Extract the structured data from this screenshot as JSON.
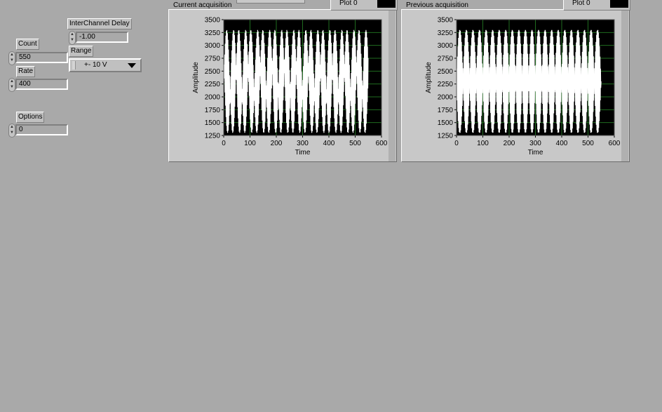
{
  "controls": {
    "count": {
      "label": "Count",
      "value": "550"
    },
    "rate": {
      "label": "Rate",
      "value": "400"
    },
    "options": {
      "label": "Options",
      "value": "0"
    },
    "interchannel_delay": {
      "label": "InterChannel Delay",
      "value": "-1.00"
    },
    "range": {
      "label": "Range",
      "value": "+- 10 V"
    }
  },
  "graphs": [
    {
      "title": "Current acquisition",
      "legend": "Plot 0"
    },
    {
      "title": "Previous acquisition",
      "legend": "Plot 0"
    }
  ],
  "colors": {
    "background": "#a9a9a9",
    "plot_bg": "#000000",
    "grid": "#1f6b1f",
    "trace": "#ffffff"
  },
  "chart_data": [
    {
      "type": "line",
      "title": "Current acquisition",
      "xlabel": "Time",
      "ylabel": "Amplitude",
      "xlim": [
        0,
        600
      ],
      "ylim": [
        1250,
        3500
      ],
      "x_ticks": [
        0,
        100,
        200,
        300,
        400,
        500,
        600
      ],
      "y_ticks": [
        1250,
        1500,
        1750,
        2000,
        2250,
        2500,
        2750,
        3000,
        3250,
        3500
      ],
      "grid": true,
      "series": [
        {
          "points": 550,
          "x_range": [
            0,
            549
          ],
          "y_range": [
            1300,
            3300
          ],
          "waveform": "dense oscillation, many interleaved cycles",
          "cycles": 12
        }
      ]
    },
    {
      "type": "line",
      "title": "Previous acquisition",
      "xlabel": "Time",
      "ylabel": "Amplitude",
      "xlim": [
        0,
        600
      ],
      "ylim": [
        1250,
        3500
      ],
      "x_ticks": [
        0,
        100,
        200,
        300,
        400,
        500,
        600
      ],
      "y_ticks": [
        1250,
        1500,
        1750,
        2000,
        2250,
        2500,
        2750,
        3000,
        3250,
        3500
      ],
      "grid": true,
      "series": [
        {
          "points": 550,
          "x_range": [
            0,
            549
          ],
          "y_range": [
            1300,
            3300
          ],
          "waveform": "interleaved sine waves, filled envelope",
          "cycles": 11
        }
      ]
    }
  ]
}
